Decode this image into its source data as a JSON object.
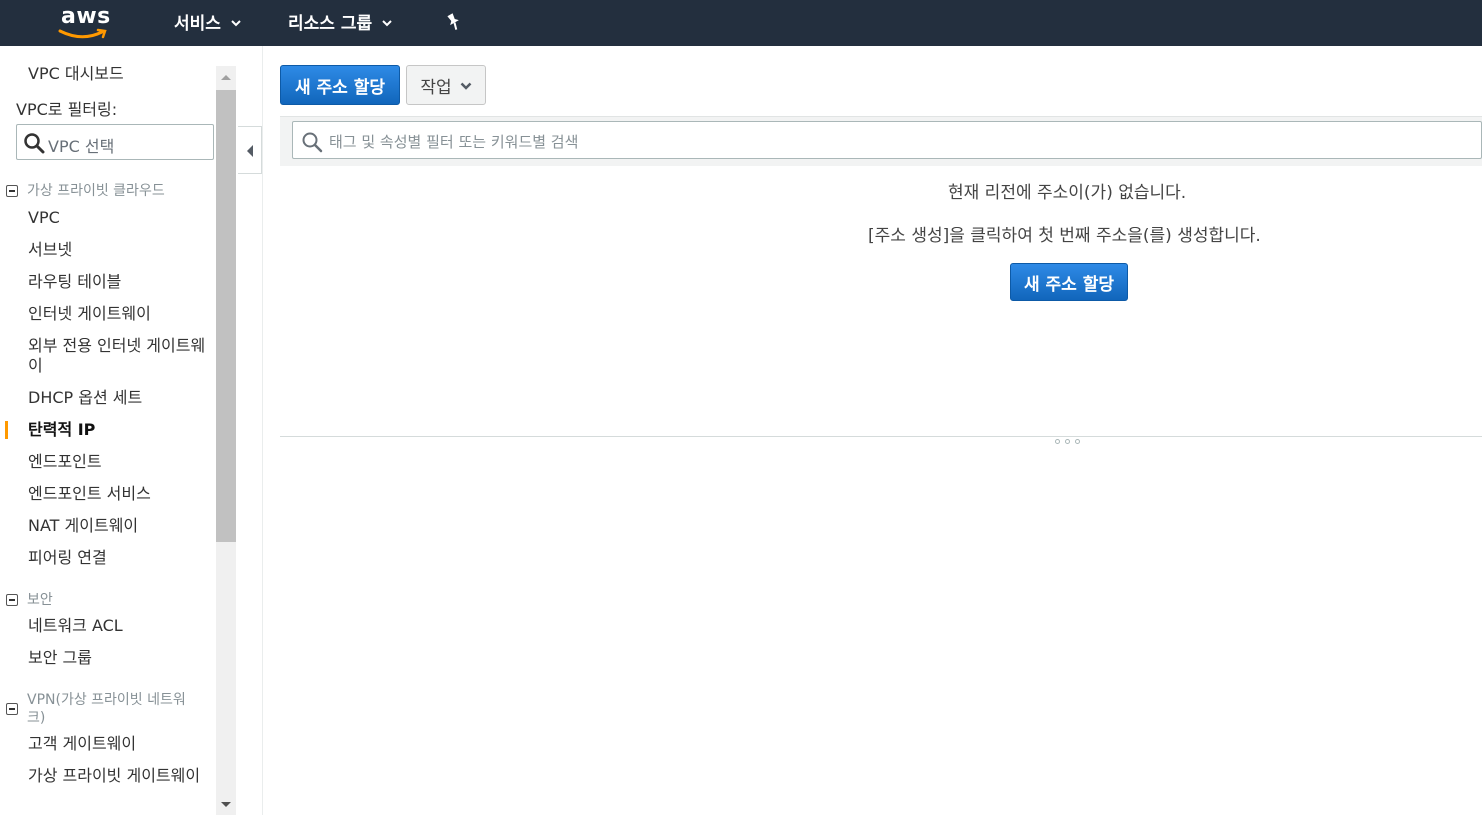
{
  "topnav": {
    "logo_text": "aws",
    "services_label": "서비스",
    "resource_groups_label": "리소스 그룹"
  },
  "sidebar": {
    "dashboard_label": "VPC 대시보드",
    "filter_label": "VPC로 필터링:",
    "vpc_select_placeholder": "VPC 선택",
    "sections": {
      "vpc": {
        "title": "가상 프라이빗 클라우드",
        "items": [
          "VPC",
          "서브넷",
          "라우팅 테이블",
          "인터넷 게이트웨이",
          "외부 전용 인터넷 게이트웨이",
          "DHCP 옵션 세트",
          "탄력적 IP",
          "엔드포인트",
          "엔드포인트 서비스",
          "NAT 게이트웨이",
          "피어링 연결"
        ]
      },
      "security": {
        "title": "보안",
        "items": [
          "네트워크 ACL",
          "보안 그룹"
        ]
      },
      "vpn": {
        "title": "VPN(가상 프라이빗 네트워크)",
        "items": [
          "고객 게이트웨이",
          "가상 프라이빗 게이트웨이"
        ]
      }
    },
    "active_item": "탄력적 IP"
  },
  "toolbar": {
    "allocate_label": "새 주소 할당",
    "actions_label": "작업"
  },
  "search": {
    "placeholder": "태그 및 속성별 필터 또는 키워드별 검색"
  },
  "empty_state": {
    "message": "현재 리전에 주소이(가) 없습니다.",
    "hint": "[주소 생성]을 클릭하여 첫 번째 주소을(를) 생성합니다.",
    "button_label": "새 주소 할당"
  },
  "colors": {
    "nav_bg": "#232f3e",
    "primary_button": "#1a73d3",
    "active_marker": "#ff9900"
  }
}
